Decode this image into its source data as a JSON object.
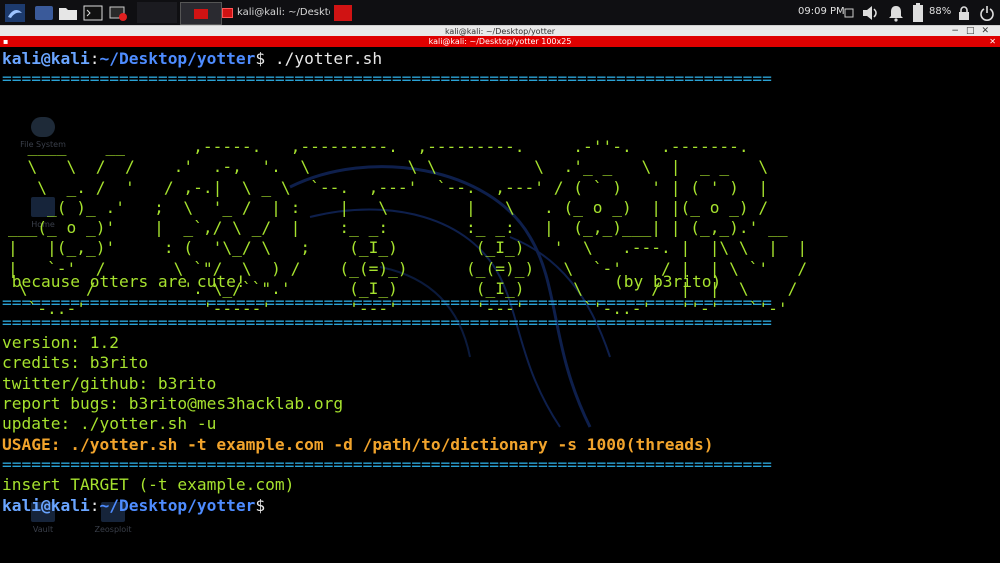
{
  "taskbar": {
    "window_title": "kali@kali: ~/Desktop/yott...",
    "clock": "09:09 PM",
    "battery": "88%"
  },
  "terminal_window": {
    "title": "kali@kali: ~/Desktop/yotter",
    "tab_title": "kali@kali: ~/Desktop/yotter 100x25"
  },
  "desktop_icons": [
    "File System",
    "Home",
    "Vault",
    "Zeosploit"
  ],
  "terminal": {
    "prompt_user": "kali@kali",
    "prompt_path": "~/Desktop/yotter",
    "command": " ./yotter.sh",
    "separator": "===============================================================================",
    "art": [
      "  ____    __       ,-----.   ,---------.  ,---------.     .-''-.   .-------.",
      "  \\   \\  /  /    .'  .-,  '.  \\          \\ \\          \\  .'_ _   \\  |  _ _   \\",
      "   \\  _. /  '   / ,-.|  \\ _ \\  `--.  ,---'  `--.  ,---' / ( ` )   ' | ( ' )  |",
      "    _( )_ .'   ;  \\  '_ /  | :    |   \\        |   \\   . (_ o _)  | |(_ o _) /",
      "___(_ o _)'    |  _`,/ \\ _/  |    :_ _:        :_ _:   |  (_,_)___| | (_,_).' __",
      "|   |(_,_)'     : (  '\\_/ \\   ;    (_I_)        (_I_)   '  \\   .---. |  |\\ \\  |  |",
      "|   `-'  /       \\ `\"/  \\  ) /    (_(=)_)      (_(=)_)   \\  `-'    / |  | \\ `'   /",
      " \\      /         '. \\_/``\".'      (_I_)        (_I_)     \\       /  |  |  \\    /",
      "  `-..-'            '-----'        '---'        '---'      `'-..-'   ''-'   `'-'"
    ],
    "tagline": " because otters are cute!",
    "byline": "(by b3rito)",
    "info": [
      "version: 1.2",
      "credits: b3rito",
      "twitter/github: b3rito",
      "report bugs: b3rito@mes3hacklab.org",
      "update: ./yotter.sh -u"
    ],
    "usage_label": "USAGE:",
    "usage_text": " ./yotter.sh -t example.com -d /path/to/dictionary -s 1000(threads)",
    "insert_target": "insert TARGET (-t example.com)"
  }
}
